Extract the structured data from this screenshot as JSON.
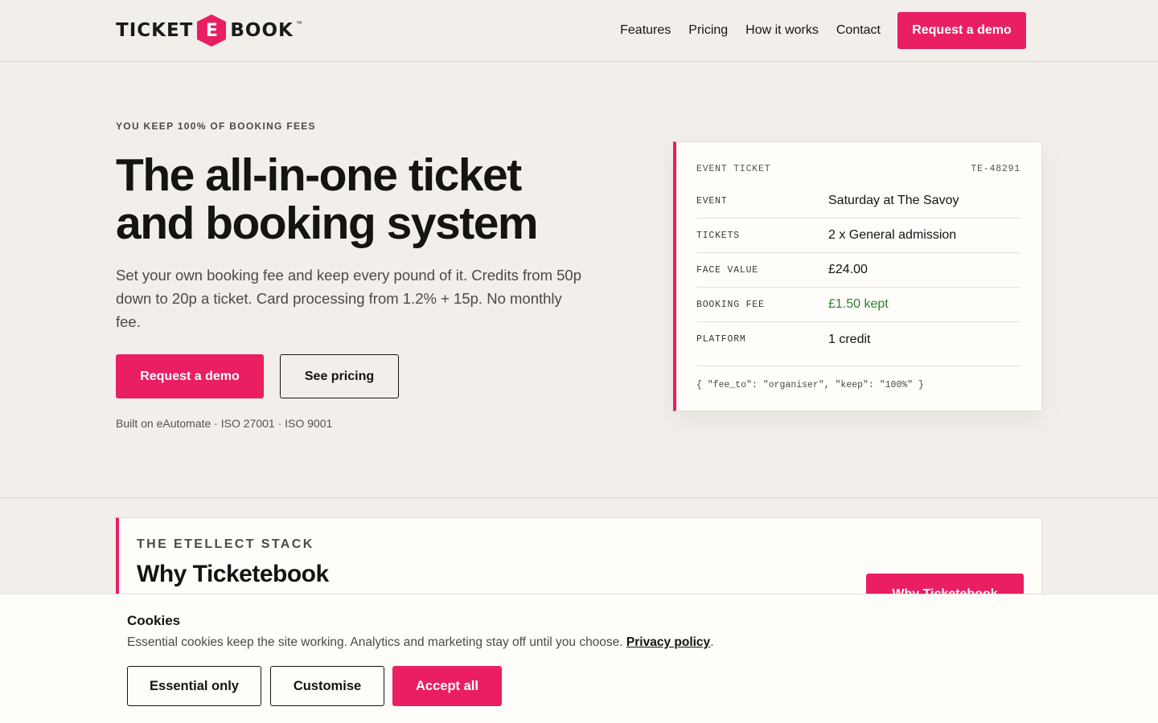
{
  "brand": {
    "logo_left": "TICKET",
    "logo_mark": "E",
    "logo_right": "BOOK",
    "logo_tm": "™",
    "accent": "#e91e63"
  },
  "nav": {
    "items": [
      "Features",
      "Pricing",
      "How it works",
      "Contact"
    ],
    "cta": "Request a demo"
  },
  "hero": {
    "eyebrow": "YOU KEEP 100% OF BOOKING FEES",
    "title_line1": "The all-in-one ticket",
    "title_line2": "and booking system",
    "subtitle": "Set your own booking fee and keep every pound of it. Credits from 50p down to 20p a ticket. Card processing from 1.2% + 15p. No monthly fee.",
    "primary_cta": "Request a demo",
    "secondary_cta": "See pricing",
    "certs": "Built on eAutomate · ISO 27001 · ISO 9001"
  },
  "ticket": {
    "label": "EVENT TICKET",
    "id": "TE-48291",
    "rows": [
      {
        "key": "EVENT",
        "value": "Saturday at The Savoy"
      },
      {
        "key": "TICKETS",
        "value": "2 x General admission"
      },
      {
        "key": "FACE VALUE",
        "value": "£24.00"
      },
      {
        "key": "BOOKING FEE",
        "value": "£1.50 kept"
      },
      {
        "key": "PLATFORM",
        "value": "1 credit"
      }
    ],
    "json": "{ \"fee_to\": \"organiser\", \"keep\": \"100%\" }",
    "positive_color": "#2e7d32"
  },
  "stack": {
    "eyebrow": "THE ETELLECT STACK",
    "title": "Why Ticketebook",
    "cta": "Why Ticketebook"
  },
  "cookies": {
    "title": "Cookies",
    "text": "Essential cookies keep the site working. Analytics and marketing stay off until you choose.",
    "link": "Privacy policy",
    "text_end": ".",
    "essential": "Essential only",
    "customise": "Customise",
    "accept": "Accept all"
  }
}
